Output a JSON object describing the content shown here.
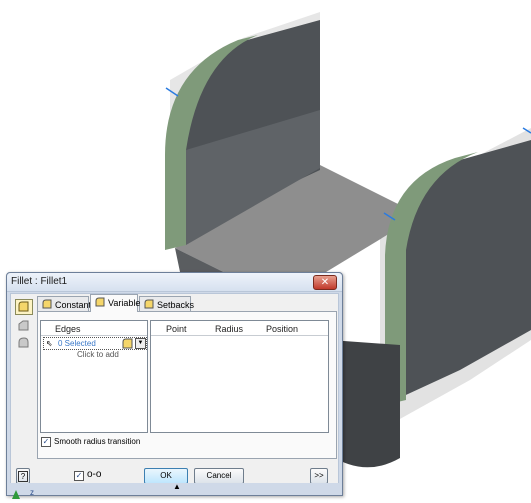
{
  "dialog": {
    "title": "Fillet : Fillet1",
    "close_icon": "close-icon",
    "tabs": [
      {
        "label": "Constant",
        "icon": "fillet-constant-icon"
      },
      {
        "label": "Variable",
        "icon": "fillet-variable-icon"
      },
      {
        "label": "Setbacks",
        "icon": "fillet-setbacks-icon"
      }
    ],
    "active_tab": "Variable",
    "edges": {
      "header": "Edges",
      "selected": "0 Selected",
      "click_to_add": "Click to add"
    },
    "points_table": {
      "columns": [
        "Point",
        "Radius",
        "Position"
      ]
    },
    "smooth_radius": {
      "label": "Smooth radius transition",
      "checked": true
    },
    "preview": {
      "checked": true,
      "icon": "glasses-preview-icon"
    },
    "buttons": {
      "ok": "OK",
      "cancel": "Cancel",
      "more": ">>",
      "help": "?"
    }
  },
  "viewport": {
    "part_color": "#4b5054",
    "fillet_color": "#7f9a7a",
    "axis_label": "z"
  }
}
